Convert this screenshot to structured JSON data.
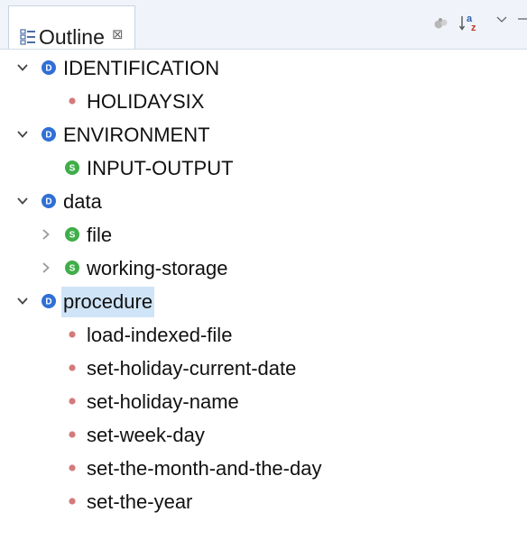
{
  "tab": {
    "label": "Outline",
    "close_glyph": "⊠",
    "icon": "outline-icon"
  },
  "toolbar": {
    "buttons": [
      {
        "name": "hide-fields-icon"
      },
      {
        "name": "sort-alphabetically-icon",
        "text": "a z"
      },
      {
        "name": "view-menu-icon"
      },
      {
        "name": "minimize-icon"
      }
    ]
  },
  "colors": {
    "division": "#2f6fd6",
    "section": "#3fae49",
    "paragraph": "#d47a7a",
    "selection": "#cfe4f7",
    "header_bg": "#f0f4fa"
  },
  "tree": [
    {
      "label": "IDENTIFICATION",
      "kind": "division",
      "badge": "D",
      "depth": 0,
      "twisty": "expanded"
    },
    {
      "label": "HOLIDAYSIX",
      "kind": "paragraph",
      "depth": 1,
      "twisty": "none"
    },
    {
      "label": "ENVIRONMENT",
      "kind": "division",
      "badge": "D",
      "depth": 0,
      "twisty": "expanded"
    },
    {
      "label": "INPUT-OUTPUT",
      "kind": "section",
      "badge": "S",
      "depth": 1,
      "twisty": "none"
    },
    {
      "label": "data",
      "kind": "division",
      "badge": "D",
      "depth": 0,
      "twisty": "expanded"
    },
    {
      "label": "file",
      "kind": "section",
      "badge": "S",
      "depth": 1,
      "twisty": "collapsed"
    },
    {
      "label": "working-storage",
      "kind": "section",
      "badge": "S",
      "depth": 1,
      "twisty": "collapsed"
    },
    {
      "label": "procedure",
      "kind": "division",
      "badge": "D",
      "depth": 0,
      "twisty": "expanded",
      "selected": true
    },
    {
      "label": "load-indexed-file",
      "kind": "paragraph",
      "depth": 1,
      "twisty": "none"
    },
    {
      "label": "set-holiday-current-date",
      "kind": "paragraph",
      "depth": 1,
      "twisty": "none"
    },
    {
      "label": "set-holiday-name",
      "kind": "paragraph",
      "depth": 1,
      "twisty": "none"
    },
    {
      "label": "set-week-day",
      "kind": "paragraph",
      "depth": 1,
      "twisty": "none"
    },
    {
      "label": "set-the-month-and-the-day",
      "kind": "paragraph",
      "depth": 1,
      "twisty": "none"
    },
    {
      "label": "set-the-year",
      "kind": "paragraph",
      "depth": 1,
      "twisty": "none"
    }
  ]
}
